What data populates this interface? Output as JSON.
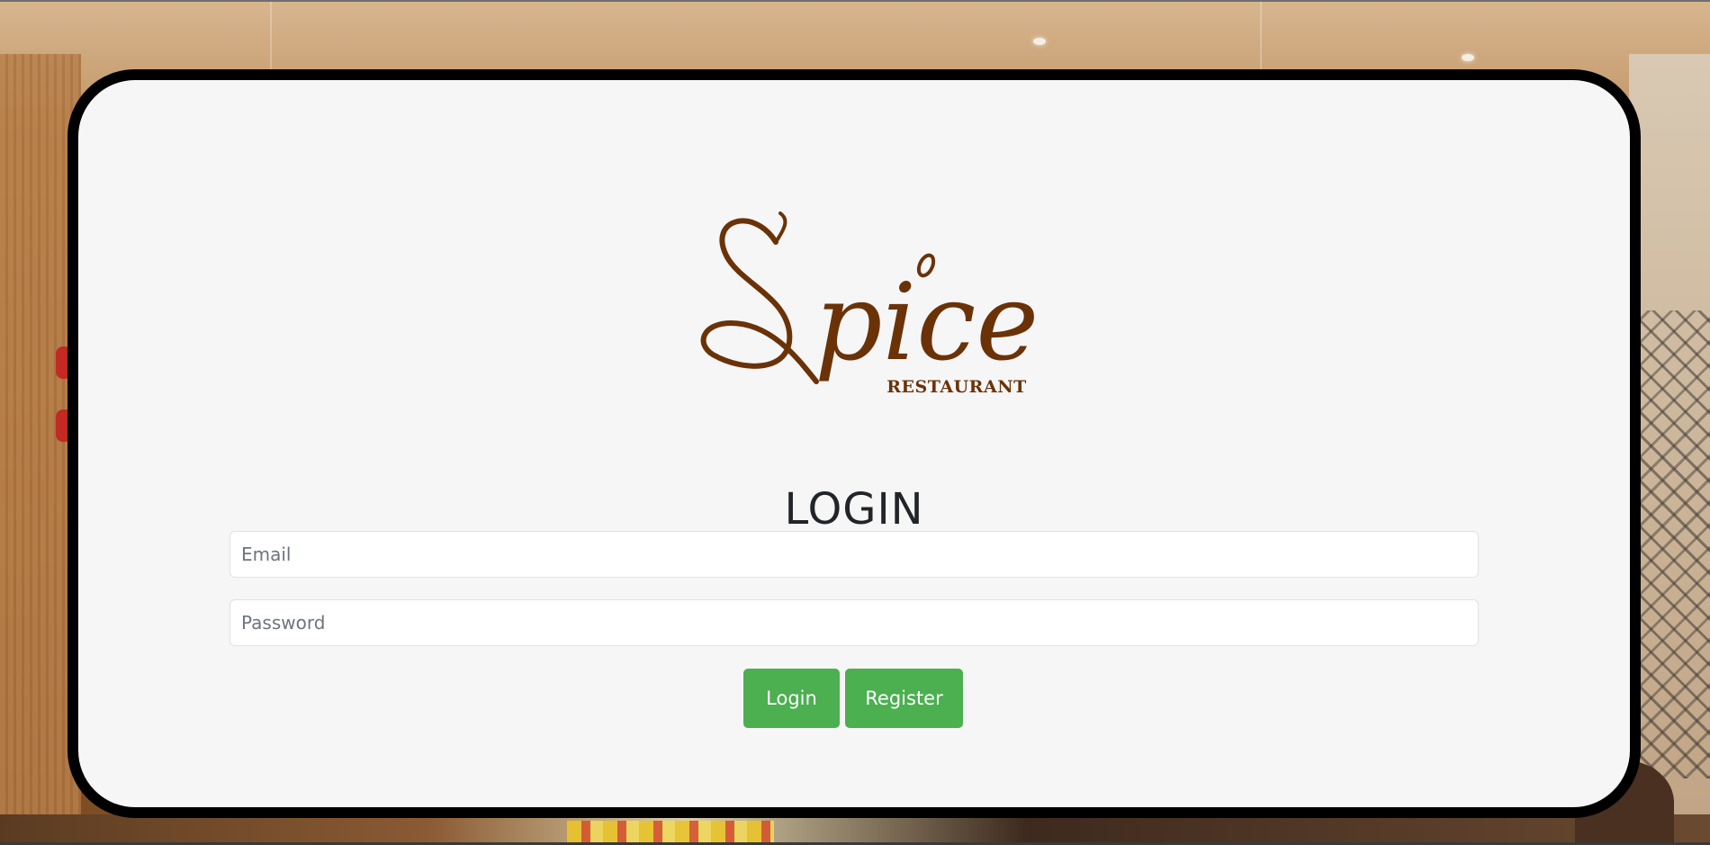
{
  "logo": {
    "wordmark": "Spice",
    "subtitle": "RESTAURANT",
    "color": "#6b3208"
  },
  "form": {
    "title": "LOGIN",
    "email_placeholder": "Email",
    "password_placeholder": "Password",
    "login_label": "Login",
    "register_label": "Register"
  },
  "colors": {
    "button": "#4caf50",
    "card_background": "#f6f6f6",
    "card_border": "#000000"
  }
}
